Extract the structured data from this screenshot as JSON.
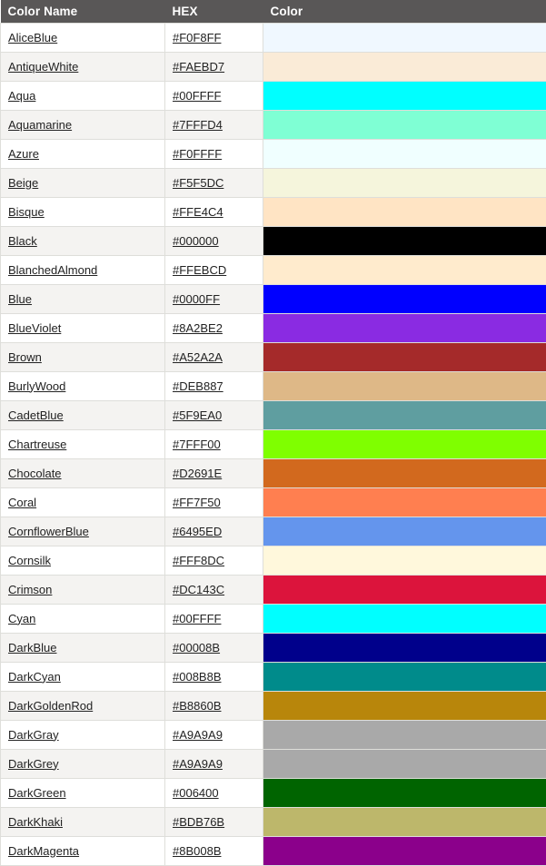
{
  "table": {
    "headers": [
      {
        "label": "Color Name",
        "key": "name"
      },
      {
        "label": "HEX",
        "key": "hex"
      },
      {
        "label": "Color",
        "key": "color"
      }
    ],
    "header_background": "#595757",
    "header_text_color": "#FFFFFF",
    "row_background_odd": "#FFFFFF",
    "row_background_even": "#F4F3F1",
    "border_color": "#DEDEDA",
    "link_color": "#222222",
    "rows": [
      {
        "name": "AliceBlue",
        "hex": "#F0F8FF",
        "color": "#F0F8FF"
      },
      {
        "name": "AntiqueWhite",
        "hex": "#FAEBD7",
        "color": "#FAEBD7"
      },
      {
        "name": "Aqua",
        "hex": "#00FFFF",
        "color": "#00FFFF"
      },
      {
        "name": "Aquamarine",
        "hex": "#7FFFD4",
        "color": "#7FFFD4"
      },
      {
        "name": "Azure",
        "hex": "#F0FFFF",
        "color": "#F0FFFF"
      },
      {
        "name": "Beige",
        "hex": "#F5F5DC",
        "color": "#F5F5DC"
      },
      {
        "name": "Bisque",
        "hex": "#FFE4C4",
        "color": "#FFE4C4"
      },
      {
        "name": "Black",
        "hex": "#000000",
        "color": "#000000"
      },
      {
        "name": "BlanchedAlmond",
        "hex": "#FFEBCD",
        "color": "#FFEBCD"
      },
      {
        "name": "Blue",
        "hex": "#0000FF",
        "color": "#0000FF"
      },
      {
        "name": "BlueViolet",
        "hex": "#8A2BE2",
        "color": "#8A2BE2"
      },
      {
        "name": "Brown",
        "hex": "#A52A2A",
        "color": "#A52A2A"
      },
      {
        "name": "BurlyWood",
        "hex": "#DEB887",
        "color": "#DEB887"
      },
      {
        "name": "CadetBlue",
        "hex": "#5F9EA0",
        "color": "#5F9EA0"
      },
      {
        "name": "Chartreuse",
        "hex": "#7FFF00",
        "color": "#7FFF00"
      },
      {
        "name": "Chocolate",
        "hex": "#D2691E",
        "color": "#D2691E"
      },
      {
        "name": "Coral",
        "hex": "#FF7F50",
        "color": "#FF7F50"
      },
      {
        "name": "CornflowerBlue",
        "hex": "#6495ED",
        "color": "#6495ED"
      },
      {
        "name": "Cornsilk",
        "hex": "#FFF8DC",
        "color": "#FFF8DC"
      },
      {
        "name": "Crimson",
        "hex": "#DC143C",
        "color": "#DC143C"
      },
      {
        "name": "Cyan",
        "hex": "#00FFFF",
        "color": "#00FFFF"
      },
      {
        "name": "DarkBlue",
        "hex": "#00008B",
        "color": "#00008B"
      },
      {
        "name": "DarkCyan",
        "hex": "#008B8B",
        "color": "#008B8B"
      },
      {
        "name": "DarkGoldenRod",
        "hex": "#B8860B",
        "color": "#B8860B"
      },
      {
        "name": "DarkGray",
        "hex": "#A9A9A9",
        "color": "#A9A9A9"
      },
      {
        "name": "DarkGrey",
        "hex": "#A9A9A9",
        "color": "#A9A9A9"
      },
      {
        "name": "DarkGreen",
        "hex": "#006400",
        "color": "#006400"
      },
      {
        "name": "DarkKhaki",
        "hex": "#BDB76B",
        "color": "#BDB76B"
      },
      {
        "name": "DarkMagenta",
        "hex": "#8B008B",
        "color": "#8B008B"
      }
    ]
  }
}
